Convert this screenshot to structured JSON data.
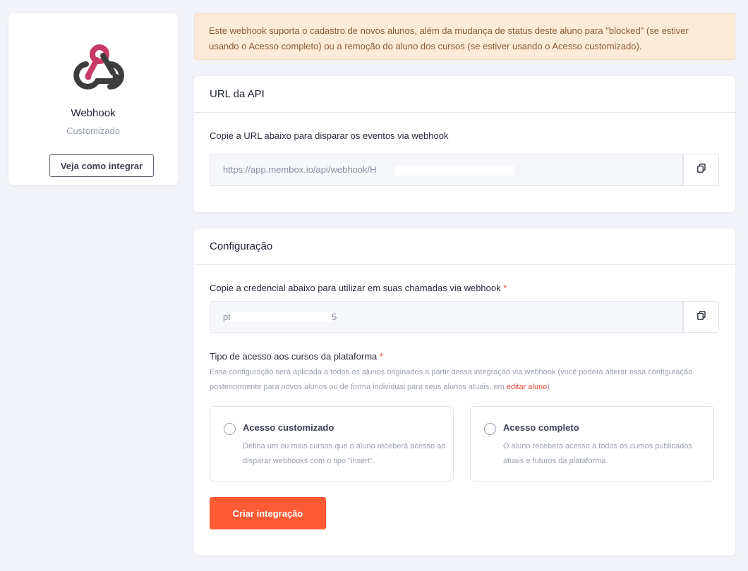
{
  "integration": {
    "name": "Webhook",
    "subtitle": "Customizado",
    "how_to_button": "Veja como integrar",
    "logo_icon": "webhook-logo-icon",
    "logo_colors": {
      "accent": "#c73b66",
      "dark": "#3d3d3f"
    }
  },
  "notice": {
    "text": "Este webhook suporta o cadastro de novos alunos, além da mudança de status deste aluno para \"blocked\" (se estiver usando o Acesso completo) ou a remoção do aluno dos cursos (se estiver usando o Acesso customizado)."
  },
  "api_section": {
    "title": "URL da API",
    "label": "Copie a URL abaixo para disparar os eventos via webhook",
    "url_value": "https://app.membox.io/api/webhook/H",
    "copy_icon": "copy-icon"
  },
  "config_section": {
    "title": "Configuração",
    "credential_label": "Copie a credencial abaixo para utilizar em suas chamadas via webhook",
    "credential_value": "pt",
    "credential_tail": "5",
    "required_mark": "*",
    "access_label": "Tipo de acesso aos cursos da plataforma",
    "access_help": "Essa configuração será aplicada a todos os alunos originados a partir dessa integração via webhook (você poderá alterar essa configuração posteriormente para novos alunos ou de forma individual para seus alunos atuais, em ",
    "access_help_link": "editar aluno",
    "access_help_end": ")",
    "options": [
      {
        "title": "Acesso customizado",
        "description": "Defina um ou mais cursos que o aluno receberá acesso ao disparar webhooks com o tipo \"insert\".",
        "selected": false
      },
      {
        "title": "Acesso completo",
        "description": "O aluno receberá acesso a todos os cursos publicados atuais e futuros da plataforma.",
        "selected": false
      }
    ],
    "submit_button": "Criar integração"
  },
  "colors": {
    "primary": "#fe5b35",
    "required": "#e5483a",
    "notice_bg": "#fcebd9",
    "notice_text": "#8a5a34"
  }
}
